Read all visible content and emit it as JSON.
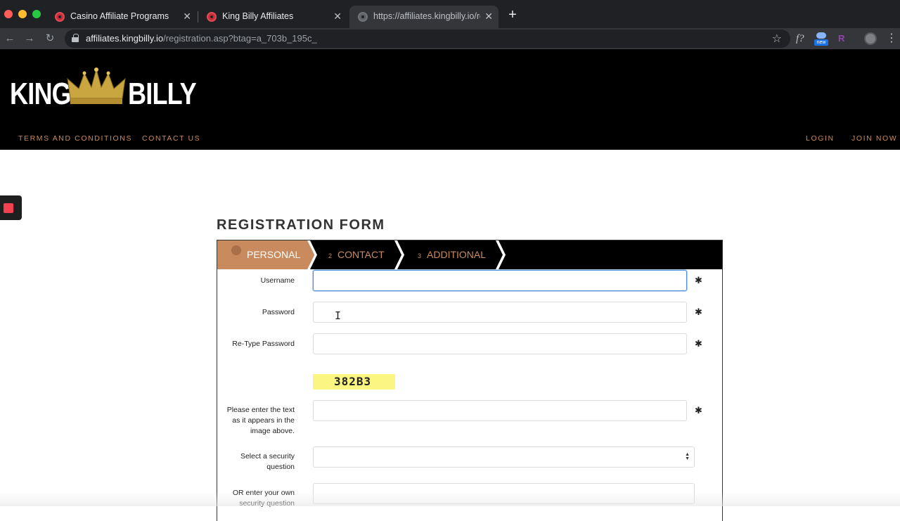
{
  "browser": {
    "tabs": [
      {
        "title": "Casino Affiliate Programs",
        "close": "✕"
      },
      {
        "title": "King Billy Affiliates",
        "close": "✕"
      },
      {
        "title": "https://affiliates.kingbilly.io/reg",
        "close": "✕"
      }
    ],
    "new_tab": "+",
    "url_host": "affiliates.kingbilly.io",
    "url_path": "/registration.asp?btag=a_703b_195c_",
    "extensions": {
      "fx": "f?",
      "new_badge": "new",
      "r": "R"
    }
  },
  "site": {
    "logo_left": "KING",
    "logo_right": "BILLY",
    "nav": {
      "terms": "TERMS AND CONDITIONS",
      "contact": "CONTACT US",
      "login": "LOGIN",
      "join": "JOIN NOW"
    },
    "colors": {
      "accent": "#c98a5d",
      "header_bg": "#000000",
      "focus": "#4a90d9"
    }
  },
  "form": {
    "title": "REGISTRATION FORM",
    "steps": [
      {
        "num": "1",
        "label": "PERSONAL",
        "active": true
      },
      {
        "num": "2",
        "label": "CONTACT",
        "active": false
      },
      {
        "num": "3",
        "label": "ADDITIONAL",
        "active": false
      }
    ],
    "fields": {
      "username_label": "Username",
      "password_label": "Password",
      "retype_label": "Re-Type Password",
      "captcha_text": "382B3",
      "captcha_label": "Please enter the text as it appears in the image above.",
      "security_label": "Select a security question",
      "own_question_label": "OR enter your own security question"
    },
    "required_marker": "✱"
  }
}
